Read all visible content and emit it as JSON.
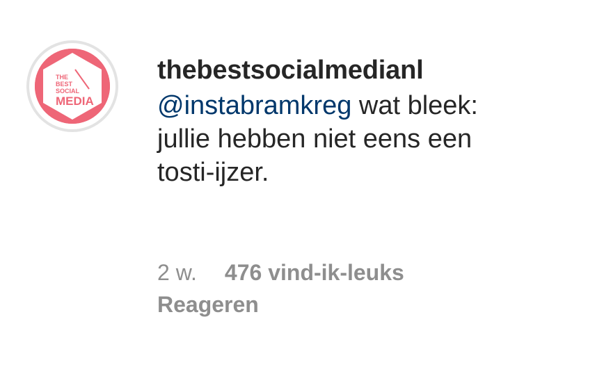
{
  "comment": {
    "avatar": {
      "logo_lines": [
        "THE",
        "BEST",
        "SOCIAL",
        "MEDIA"
      ],
      "ring_color": "#e3e3e3",
      "badge_color": "#ee6677"
    },
    "username": "thebestsocialmedianl",
    "mention": "@instabramkreg",
    "text_after_mention": " wat bleek:",
    "text_line_2": "jullie hebben niet eens een",
    "text_line_3": "tosti-ijzer.",
    "mention_color": "#00376b",
    "time_ago": "2 w.",
    "likes": "476 vind-ik-leuks",
    "reply_label": "Reageren"
  }
}
